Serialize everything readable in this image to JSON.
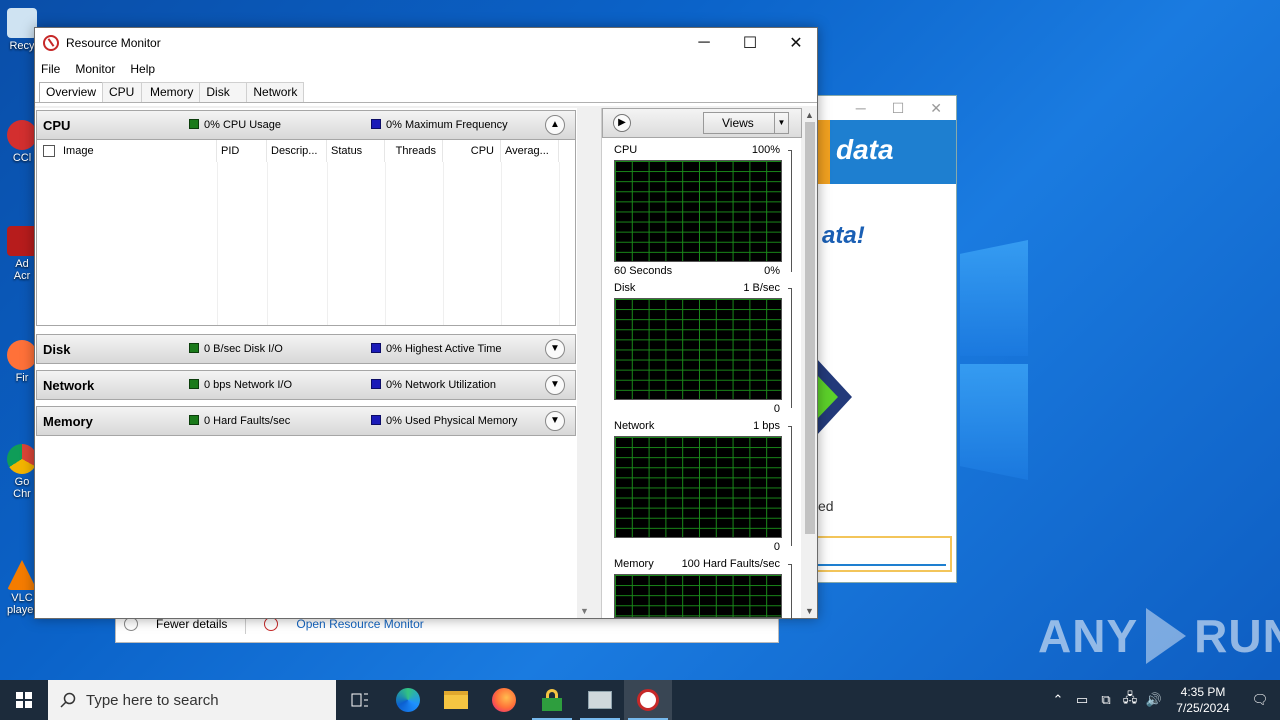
{
  "window": {
    "title": "Resource Monitor",
    "controls": {
      "minimize": "─",
      "maximize": "☐",
      "close": "✕"
    }
  },
  "menu": [
    "File",
    "Monitor",
    "Help"
  ],
  "tabs": [
    {
      "label": "Overview",
      "active": true
    },
    {
      "label": "CPU"
    },
    {
      "label": "Memory"
    },
    {
      "label": "Disk"
    },
    {
      "label": "Network"
    }
  ],
  "sections": {
    "cpu": {
      "name": "CPU",
      "metric1": "0% CPU Usage",
      "metric2": "0% Maximum Frequency",
      "expanded": true
    },
    "disk": {
      "name": "Disk",
      "metric1": "0 B/sec Disk I/O",
      "metric2": "0% Highest Active Time"
    },
    "network": {
      "name": "Network",
      "metric1": "0 bps Network I/O",
      "metric2": "0% Network Utilization"
    },
    "memory": {
      "name": "Memory",
      "metric1": "0 Hard Faults/sec",
      "metric2": "0% Used Physical Memory"
    }
  },
  "cpu_table": {
    "columns": [
      "Image",
      "PID",
      "Descrip...",
      "Status",
      "Threads",
      "CPU",
      "Averag..."
    ],
    "rows": []
  },
  "right_panel": {
    "views_label": "Views",
    "graphs": [
      {
        "name": "CPU",
        "max": "100%",
        "footer_left": "60 Seconds",
        "footer_right": "0%"
      },
      {
        "name": "Disk",
        "max": "1 B/sec",
        "footer_right": "0"
      },
      {
        "name": "Network",
        "max": "1 bps",
        "footer_right": "0"
      },
      {
        "name": "Memory",
        "max": "100 Hard Faults/sec"
      }
    ]
  },
  "background_windows": {
    "task_manager": {
      "fewer_details": "Fewer details",
      "open_resmon": "Open Resource Monitor"
    },
    "installer": {
      "banner_text": "data",
      "heading": "ata!",
      "status_text": "ed"
    }
  },
  "desktop_icons": [
    {
      "label": "Recy",
      "icon": "recycle-bin-icon"
    },
    {
      "label": "CCl",
      "icon": "ccleaner-icon"
    },
    {
      "label": "Ad Acr",
      "icon": "acrobat-icon"
    },
    {
      "label": "Fir",
      "icon": "firefox-icon"
    },
    {
      "label": "Go Chr",
      "icon": "chrome-icon"
    },
    {
      "label": "VLC player",
      "icon": "vlc-icon"
    }
  ],
  "watermark": {
    "left": "ANY",
    "right": "RUN"
  },
  "taskbar": {
    "search_placeholder": "Type here to search",
    "apps": [
      "task-view-icon",
      "edge-icon",
      "file-explorer-icon",
      "firefox-icon",
      "lock-app-icon",
      "network-app-icon",
      "resource-monitor-icon"
    ],
    "time": "4:35 PM",
    "date": "7/25/2024"
  },
  "colors": {
    "accent": "#0078d7",
    "graph_grid": "#1a8a1a",
    "green_marker": "#1a7a1a",
    "blue_marker": "#1a1ab8",
    "taskbar": "#1c2b3b"
  }
}
